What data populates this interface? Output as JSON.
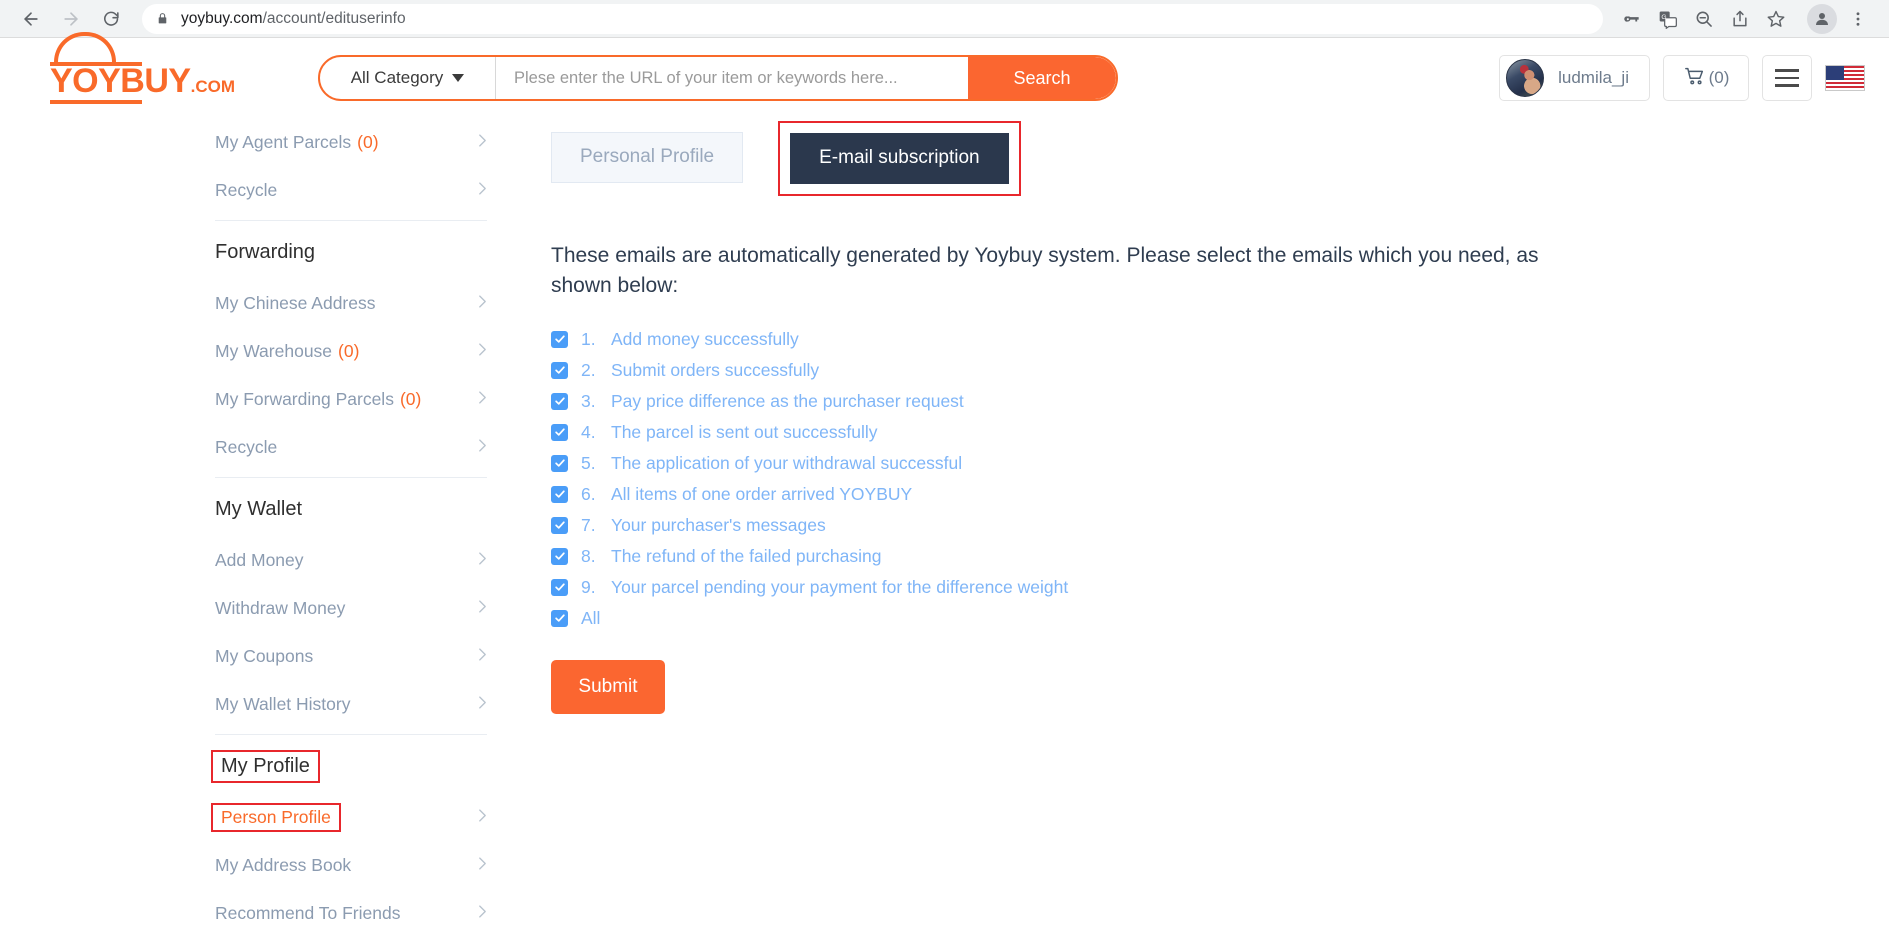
{
  "browser": {
    "url_host": "yoybuy.com",
    "url_path": "/account/edituserinfo",
    "back_icon": "back-arrow-icon",
    "forward_icon": "forward-arrow-icon",
    "reload_icon": "reload-icon",
    "lock_icon": "lock-icon",
    "toolbar_icons": [
      "password-key-icon",
      "translate-icon",
      "zoom-out-icon",
      "share-icon",
      "bookmark-star-icon",
      "profile-avatar-icon",
      "more-menu-icon"
    ]
  },
  "header": {
    "logo_text": "YOYBUY",
    "logo_suffix": ".COM",
    "category_label": "All Category",
    "search_placeholder": "Plese enter the URL of your item or keywords here...",
    "search_value": "",
    "search_button": "Search",
    "user_name": "ludmila_ji",
    "cart_count": "(0)",
    "language_flag": "us-flag-icon"
  },
  "sidebar": {
    "groups": [
      {
        "title": null,
        "items": [
          {
            "label": "My Agent Parcels",
            "count": "(0)",
            "chevron": true,
            "style": "normal"
          },
          {
            "label": "Recycle",
            "count": "",
            "chevron": true,
            "style": "normal"
          }
        ]
      },
      {
        "title": "Forwarding",
        "items": [
          {
            "label": "My Chinese Address",
            "count": "",
            "chevron": true,
            "style": "normal"
          },
          {
            "label": "My Warehouse",
            "count": "(0)",
            "chevron": true,
            "style": "normal"
          },
          {
            "label": "My Forwarding Parcels",
            "count": "(0)",
            "chevron": true,
            "style": "normal"
          },
          {
            "label": "Recycle",
            "count": "",
            "chevron": true,
            "style": "normal"
          }
        ]
      },
      {
        "title": "My Wallet",
        "items": [
          {
            "label": "Add Money",
            "count": "",
            "chevron": true,
            "style": "normal"
          },
          {
            "label": "Withdraw Money",
            "count": "",
            "chevron": true,
            "style": "normal"
          },
          {
            "label": "My Coupons",
            "count": "",
            "chevron": true,
            "style": "normal"
          },
          {
            "label": "My Wallet History",
            "count": "",
            "chevron": true,
            "style": "normal"
          }
        ]
      },
      {
        "title": "My Profile",
        "title_annotated": true,
        "items": [
          {
            "label": "Person Profile",
            "count": "",
            "chevron": true,
            "style": "orange",
            "annotated": true
          },
          {
            "label": "My Address Book",
            "count": "",
            "chevron": true,
            "style": "normal"
          },
          {
            "label": "Recommend To Friends",
            "count": "",
            "chevron": true,
            "style": "normal"
          }
        ]
      }
    ]
  },
  "main": {
    "tabs": [
      {
        "label": "Personal Profile",
        "active": false,
        "annotated": false
      },
      {
        "label": "E-mail subscription",
        "active": true,
        "annotated": true
      }
    ],
    "intro": "These emails are automatically generated by Yoybuy system. Please select the emails which you need, as shown below:",
    "options": [
      {
        "num": "1.",
        "label": "Add money successfully",
        "checked": true
      },
      {
        "num": "2.",
        "label": "Submit orders successfully",
        "checked": true
      },
      {
        "num": "3.",
        "label": "Pay price difference as the purchaser request",
        "checked": true
      },
      {
        "num": "4.",
        "label": "The parcel is sent out successfully",
        "checked": true
      },
      {
        "num": "5.",
        "label": "The application of your withdrawal successful",
        "checked": true
      },
      {
        "num": "6.",
        "label": "All items of one order arrived YOYBUY",
        "checked": true
      },
      {
        "num": "7.",
        "label": "Your purchaser's messages",
        "checked": true
      },
      {
        "num": "8.",
        "label": "The refund of the failed purchasing",
        "checked": true
      },
      {
        "num": "9.",
        "label": "Your parcel pending your payment for the difference weight",
        "checked": true
      },
      {
        "num": "",
        "label": "All",
        "checked": true
      }
    ],
    "submit_label": "Submit"
  },
  "colors": {
    "brand_orange": "#fb6630",
    "accent_blue": "#7fb5f7",
    "checkbox_blue": "#4a9df8",
    "tab_active_bg": "#2b384d",
    "annotation_red": "#e8272c",
    "sidebar_text": "#8b9bb0"
  }
}
